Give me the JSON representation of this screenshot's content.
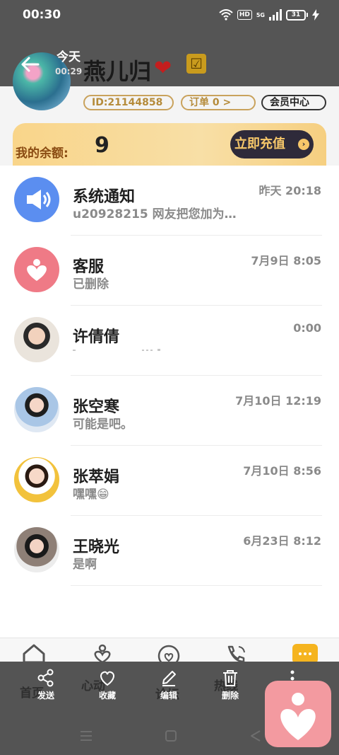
{
  "status_bar": {
    "time": "00:30",
    "hd": "HD",
    "signal": "5G",
    "battery": "31"
  },
  "header": {
    "date": "今天",
    "time": "00:29",
    "nickname": "燕儿归",
    "heart_emoji": "❤",
    "check_emoji": "☑",
    "id_text": "ID:21144858",
    "subscribe_text": "订单 0 >",
    "member_text": "会员中心"
  },
  "balance": {
    "label": "我的余额:",
    "value": "9",
    "recharge_label": "立即充值"
  },
  "messages": [
    {
      "name": "系统通知",
      "time": "昨天 20:18",
      "preview": "u20928215 网友把您加为…",
      "avatar": "megaphone-icon"
    },
    {
      "name": "客服",
      "time": "7月9日 8:05",
      "preview": "已删除",
      "avatar": "heart-icon"
    },
    {
      "name": "许倩倩",
      "time": "0:00",
      "preview": "",
      "avatar": "photo"
    },
    {
      "name": "张空寒",
      "time": "7月10日 12:19",
      "preview": "可能是吧。",
      "avatar": "photo"
    },
    {
      "name": "张萃娟",
      "time": "7月10日 8:56",
      "preview": "嘿嘿😁",
      "avatar": "photo"
    },
    {
      "name": "王晓光",
      "time": "6月23日 8:12",
      "preview": "是啊",
      "avatar": "photo"
    }
  ],
  "tabs": {
    "home": "首页",
    "heart_tab": "心动",
    "forum": "论坛",
    "hot": "热线"
  },
  "actions": {
    "send": "发送",
    "favorite": "收藏",
    "edit": "编辑",
    "delete": "删除"
  },
  "colors": {
    "accent_gold": "#f5b41f",
    "fab_pink": "#f39aa0",
    "overlay": "#545454"
  }
}
